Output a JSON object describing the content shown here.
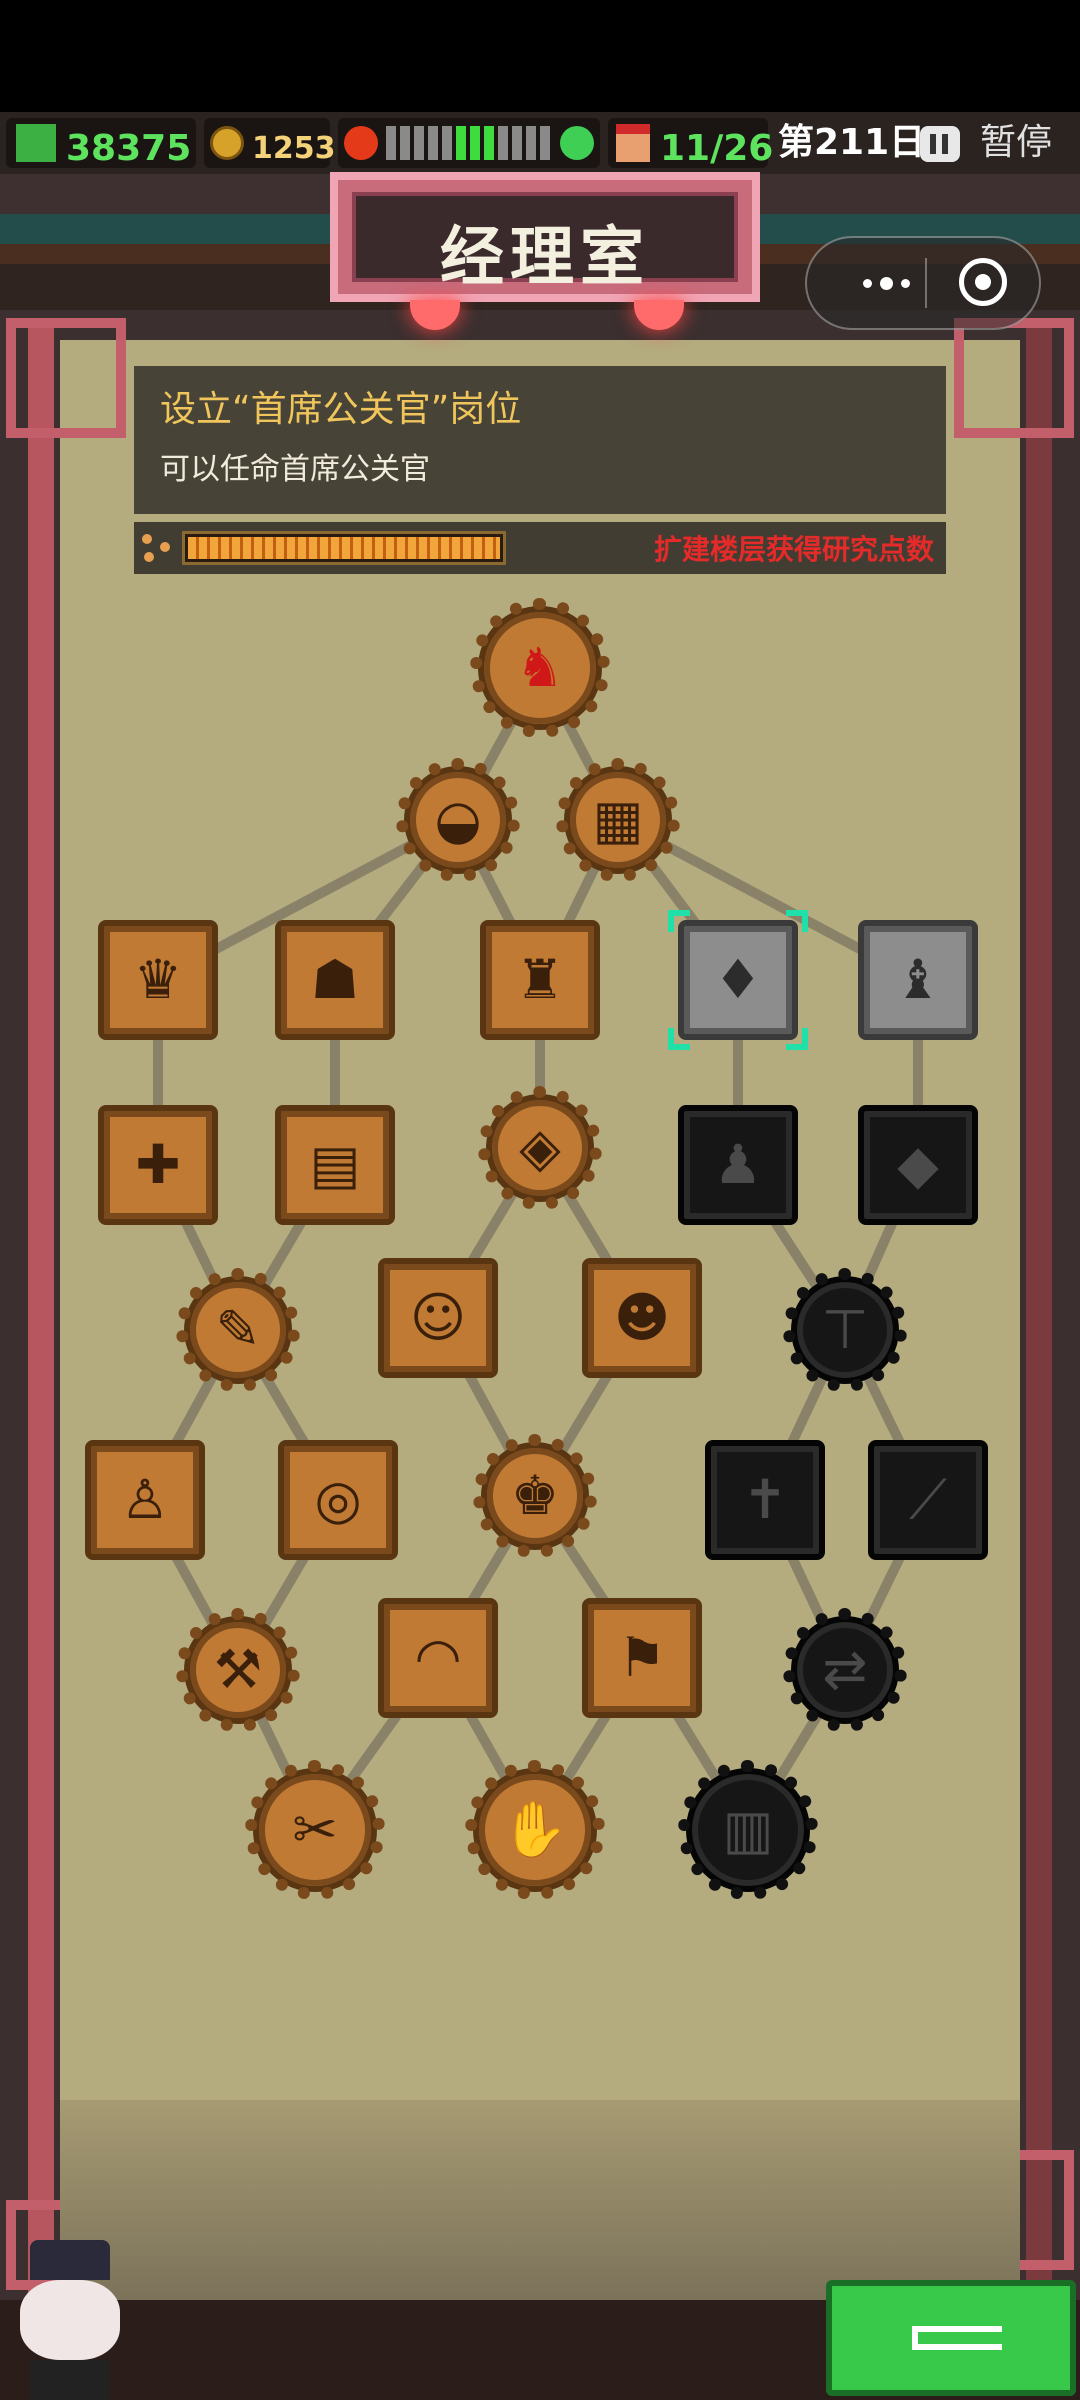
{
  "status_bar": {
    "cash": "38375",
    "coins": "1253",
    "mood_segments": [
      0,
      0,
      0,
      0,
      0,
      1,
      1,
      1,
      0,
      0,
      0,
      0
    ],
    "staff": "11/26",
    "day": "第211日",
    "pause_label": "暂停"
  },
  "room_title": "经理室",
  "info_panel": {
    "title": "设立“首席公关官”岗位",
    "description": "可以任命首席公关官"
  },
  "research": {
    "progress": 1.0,
    "hint": "扩建楼层获得研究点数"
  },
  "tree_nodes": [
    {
      "id": "root",
      "state": "unlocked",
      "icon": "red-rooster-icon",
      "glyph": "♞"
    },
    {
      "id": "r1a",
      "state": "unlocked",
      "icon": "cake-icon",
      "glyph": "◒"
    },
    {
      "id": "r1b",
      "state": "unlocked",
      "icon": "brick-wall-icon",
      "glyph": "▦"
    },
    {
      "id": "r2a",
      "state": "unlocked",
      "icon": "staff-crown-icon",
      "glyph": "♛"
    },
    {
      "id": "r2b",
      "state": "unlocked",
      "icon": "staff-desk-icon",
      "glyph": "☗"
    },
    {
      "id": "r2c",
      "state": "unlocked",
      "icon": "officer-icon",
      "glyph": "♜"
    },
    {
      "id": "r2d",
      "state": "available",
      "icon": "pr-officer-icon",
      "glyph": "♦"
    },
    {
      "id": "r2e",
      "state": "available",
      "icon": "receptionist-icon",
      "glyph": "♝"
    },
    {
      "id": "r3a",
      "state": "unlocked",
      "icon": "medic-icon",
      "glyph": "✚"
    },
    {
      "id": "r3b",
      "state": "unlocked",
      "icon": "counter-icon",
      "glyph": "▤"
    },
    {
      "id": "r3c",
      "state": "unlocked",
      "icon": "diamond-hand-icon",
      "glyph": "◈"
    },
    {
      "id": "r3d",
      "state": "locked",
      "icon": "crowd-icon",
      "glyph": "♟"
    },
    {
      "id": "r3e",
      "state": "locked",
      "icon": "diamond-tile-icon",
      "glyph": "◆"
    },
    {
      "id": "r4a",
      "state": "unlocked",
      "icon": "bandage-icon",
      "glyph": "✎"
    },
    {
      "id": "r4b",
      "state": "unlocked",
      "icon": "meeting-icon",
      "glyph": "☺"
    },
    {
      "id": "r4c",
      "state": "unlocked",
      "icon": "group-icon",
      "glyph": "☻"
    },
    {
      "id": "r4d",
      "state": "locked",
      "icon": "signpost-icon",
      "glyph": "⊤"
    },
    {
      "id": "r5a",
      "state": "unlocked",
      "icon": "worker-desk-icon",
      "glyph": "♙"
    },
    {
      "id": "r5b",
      "state": "unlocked",
      "icon": "spiral-icon",
      "glyph": "◎"
    },
    {
      "id": "r5c",
      "state": "unlocked",
      "icon": "team-icon",
      "glyph": "♚"
    },
    {
      "id": "r5d",
      "state": "locked",
      "icon": "cross-icon",
      "glyph": "✝"
    },
    {
      "id": "r5e",
      "state": "locked",
      "icon": "rifle-icon",
      "glyph": "⟋"
    },
    {
      "id": "r6a",
      "state": "unlocked",
      "icon": "wrench-icon",
      "glyph": "⚒"
    },
    {
      "id": "r6b",
      "state": "unlocked",
      "icon": "lips-icon",
      "glyph": "◠"
    },
    {
      "id": "r6c",
      "state": "unlocked",
      "icon": "flag-icon",
      "glyph": "⚑"
    },
    {
      "id": "r6d",
      "state": "locked",
      "icon": "swap-icon",
      "glyph": "⇄"
    },
    {
      "id": "r7a",
      "state": "unlocked",
      "icon": "tools-icon",
      "glyph": "✂"
    },
    {
      "id": "r7b",
      "state": "unlocked",
      "icon": "handshake-icon",
      "glyph": "✋"
    },
    {
      "id": "r7c",
      "state": "locked",
      "icon": "monument-icon",
      "glyph": "▥"
    }
  ]
}
